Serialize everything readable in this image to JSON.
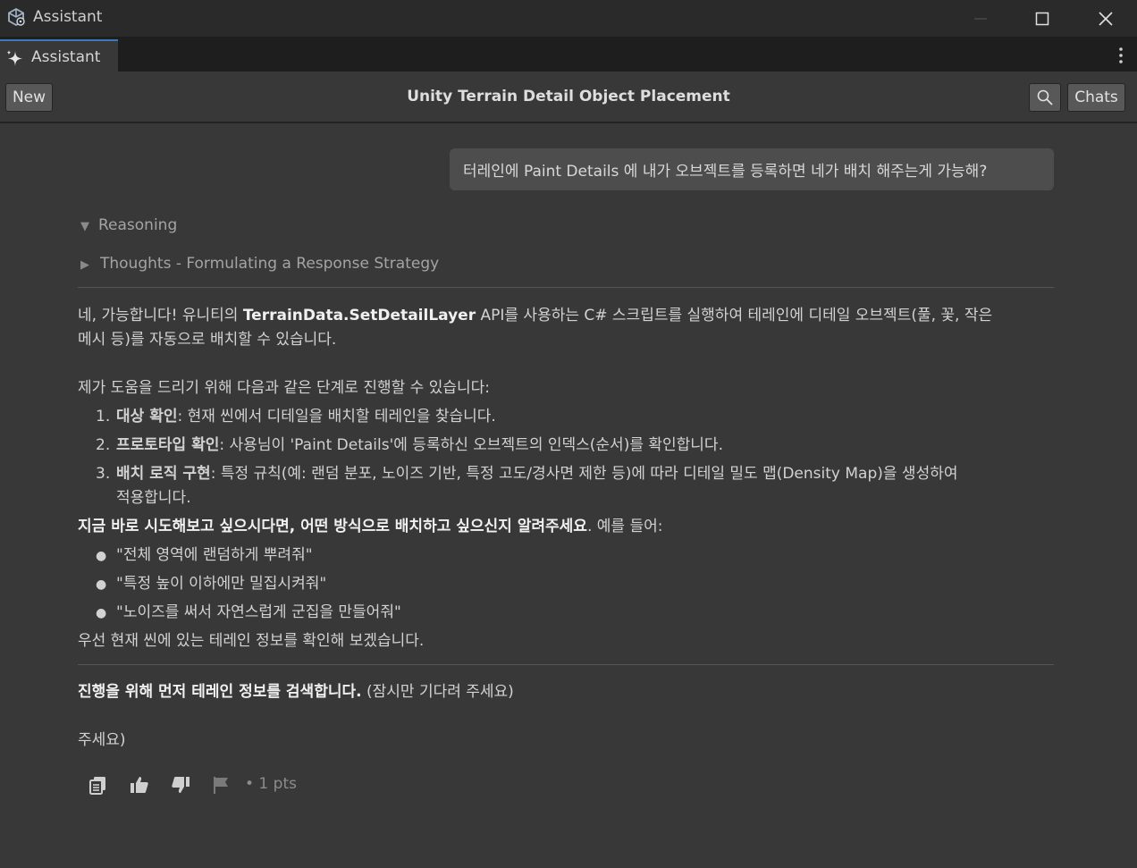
{
  "window": {
    "title": "Assistant"
  },
  "tab": {
    "label": "Assistant"
  },
  "toolbar": {
    "new_label": "New",
    "conversation_title": "Unity Terrain Detail Object Placement",
    "chats_label": "Chats"
  },
  "user_message": "터레인에 Paint Details 에 내가 오브젝트를 등록하면 네가 배치 해주는게 가능해?",
  "reasoning": {
    "label": "Reasoning",
    "thoughts_label": "Thoughts - Formulating a Response Strategy"
  },
  "response": {
    "intro_1": "네, 가능합니다! 유니티의 ",
    "intro_api": "TerrainData.SetDetailLayer",
    "intro_2": " API를 사용하는 C# 스크립트를 실행하여 테레인에 디테일 오브젝트(풀, 꽃, 작은",
    "intro_3": "메시 등)를 자동으로 배치할 수 있습니다.",
    "steps_intro": "제가 도움을 드리기 위해 다음과 같은 단계로 진행할 수 있습니다:",
    "steps": [
      {
        "num": "1.",
        "title": "대상 확인",
        "text": ": 현재 씬에서 디테일을 배치할 테레인을 찾습니다."
      },
      {
        "num": "2.",
        "title": "프로토타입 확인",
        "text": ": 사용님이 'Paint Details'에 등록하신 오브젝트의 인덱스(순서)를 확인합니다."
      },
      {
        "num": "3.",
        "title": "배치 로직 구현",
        "text": ": 특정 규칙(예: 랜덤 분포, 노이즈 기반, 특정 고도/경사면 제한 등)에 따라 디테일 밀도 맵(Density Map)을 생성하여",
        "text2": "적용합니다."
      }
    ],
    "cta_bold_1": "지금 바로 시도해보고 싶으시다면,",
    "cta_bold_2": " 어떤 방식으로 배치하고 싶으신지 알려주세요",
    "cta_rest": ". 예를 들어:",
    "examples": [
      "\"전체 영역에 랜덤하게 뿌려줘\"",
      "\"특정 높이 이하에만 밀집시켜줘\"",
      "\"노이즈를 써서 자연스럽게 군집을 만들어줘\""
    ],
    "closing": "우선 현재 씬에 있는 테레인 정보를 확인해 보겠습니다.",
    "progress_bold": "진행을 위해 먼저 테레인 정보를 검색합니다.",
    "progress_rest": " (잠시만 기다려 주세요)",
    "trailing": "주세요)"
  },
  "feedback": {
    "pts": "• 1 pts"
  }
}
